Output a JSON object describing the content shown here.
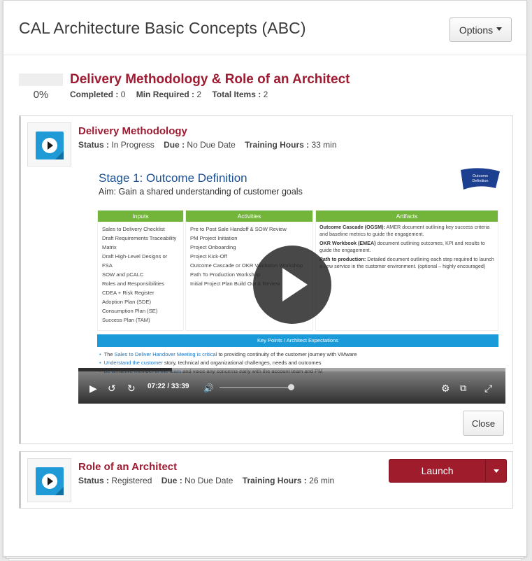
{
  "header": {
    "title": "CAL Architecture Basic Concepts (ABC)",
    "options_label": "Options"
  },
  "section": {
    "title": "Delivery Methodology & Role of an Architect",
    "progress_fraction": 0,
    "progress_text": "0%",
    "completed_label": "Completed :",
    "completed_value": "0",
    "min_required_label": "Min Required :",
    "min_required_value": "2",
    "total_items_label": "Total Items :",
    "total_items_value": "2"
  },
  "items": [
    {
      "title": "Delivery Methodology",
      "status_label": "Status :",
      "status_value": "In Progress",
      "due_label": "Due :",
      "due_value": "No Due Date",
      "hours_label": "Training Hours :",
      "hours_value": "33 min",
      "close_label": "Close"
    },
    {
      "title": "Role of an Architect",
      "status_label": "Status :",
      "status_value": "Registered",
      "due_label": "Due :",
      "due_value": "No Due Date",
      "hours_label": "Training Hours :",
      "hours_value": "26 min",
      "launch_label": "Launch"
    }
  ],
  "video": {
    "current_time": "07:22",
    "separator": "/",
    "duration": "33:39",
    "played_fraction": 0.219,
    "volume_fraction": 1.0,
    "slide": {
      "title": "Stage 1: Outcome Definition",
      "aim": "Aim: Gain a shared understanding of customer goals",
      "badge": "Outcome Definition",
      "columns": [
        {
          "header": "Inputs",
          "items": [
            "Sales to Delivery Checklist",
            "Draft Requirements Traceability Matrix",
            "Draft High-Level Designs or FSA",
            "SOW and pCALC",
            "Roles and Responsibilities",
            "CDEA + Risk Register",
            "Adoption Plan (SDE)",
            "Consumption Plan (SE)",
            "Success Plan (TAM)"
          ]
        },
        {
          "header": "Activities",
          "items": [
            "Pre to Post Sale Handoff & SOW Review",
            "PM Project Initiation",
            "Project Onboarding",
            "Project Kick-Off",
            "Outcome Cascade or OKR Validation Workshop",
            "Path To Production Workshop",
            "Initial Project Plan Build Out & Review"
          ]
        },
        {
          "header": "Artifacts",
          "entries": [
            {
              "term": "Outcome Cascade (OGSM):",
              "desc": "AMER document outlining key success criteria and baseline metrics to guide the engagement."
            },
            {
              "term": "OKR Workbook (EMEA)",
              "desc": "document outlining outcomes, KPI and results to guide the engagement."
            },
            {
              "term": "Path to production:",
              "desc": "Detailed document outlining each step required to launch a new service in the customer environment. (optional – highly encouraged)"
            }
          ]
        }
      ],
      "key_points_header": "Key Points / Architect Expectations",
      "key_points": [
        {
          "lead": "The ",
          "link": "Sales to Deliver Handover Meeting is critical",
          "rest": " to providing continuity of the customer journey with VMware"
        },
        {
          "lead": "",
          "link": "Understand the customer",
          "rest": " story, technical and organizational challenges, needs and outcomes"
        },
        {
          "lead": "",
          "link": "Be an active member of the team",
          "rest": " and voice any concerns early with the account team and PM"
        }
      ]
    }
  },
  "colors": {
    "brand_red": "#9e1b32",
    "launch_red": "#9f1c2c",
    "slide_green": "#73b53a",
    "slide_blue": "#1a9ad8",
    "thumb_blue": "#1f9ad6"
  }
}
